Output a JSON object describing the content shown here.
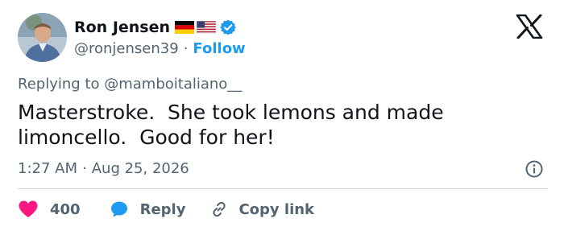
{
  "author": {
    "display_name": "Ron Jensen",
    "handle": "@ronjensen39",
    "separator": "·",
    "follow_label": "Follow",
    "flags": [
      "germany-flag",
      "usa-flag"
    ],
    "verified_color": "#1d9bf0"
  },
  "reply_context": {
    "prefix": "Replying to",
    "handle": "@mamboitaliano__"
  },
  "tweet": {
    "text": "Masterstroke.  She took lemons and made\nlimoncello.  Good for her!",
    "time": "1:27 AM",
    "separator": "·",
    "date": "Aug 25, 2026"
  },
  "actions": {
    "like_count": "400",
    "reply_label": "Reply",
    "copy_label": "Copy link"
  },
  "colors": {
    "accent": "#1d9bf0",
    "like": "#f91880",
    "muted": "#536471",
    "text": "#0f1419"
  },
  "icons": [
    "x-logo-icon",
    "verified-badge-icon",
    "info-icon",
    "heart-icon",
    "reply-bubble-icon",
    "link-icon"
  ]
}
